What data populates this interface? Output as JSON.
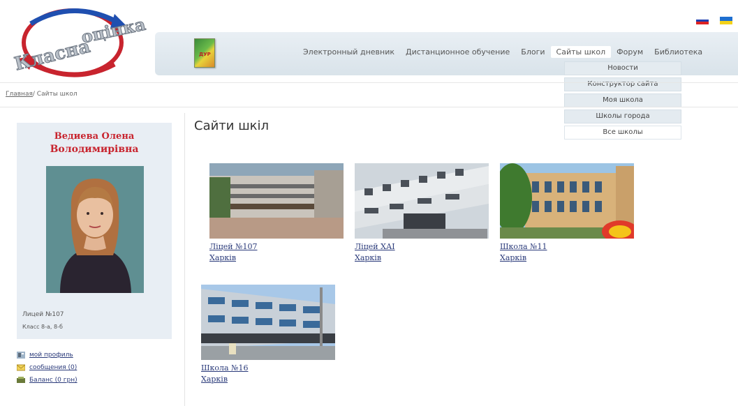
{
  "logo": {
    "text": "Класна оцінка"
  },
  "flags": [
    {
      "name": "russian-flag",
      "colors": [
        "#ffffff",
        "#1f3fb0",
        "#d22"
      ]
    },
    {
      "name": "ukrainian-flag",
      "colors": [
        "#1e6fd0",
        "#f4d21a"
      ]
    }
  ],
  "nav": {
    "items": [
      {
        "label": "Электронный дневник",
        "active": false
      },
      {
        "label": "Дистанционное обучение",
        "active": false
      },
      {
        "label": "Блоги",
        "active": false
      },
      {
        "label": "Сайты школ",
        "active": true
      },
      {
        "label": "Форум",
        "active": false
      },
      {
        "label": "Библиотека",
        "active": false
      }
    ],
    "dropdown": [
      "Новости",
      "Конструктор сайта",
      "Моя школа",
      "Школы города",
      "Все школы"
    ]
  },
  "breadcrumb": {
    "home": "Главная",
    "separator": "/",
    "current": "Сайты школ"
  },
  "profile": {
    "name_line1": "Ведиева Олена",
    "name_line2": "Володимирівна",
    "school": "Лицей №107",
    "class": "Класс 8-а, 8-б"
  },
  "sidebar_links": [
    {
      "label": "мой профиль",
      "icon": "profile-icon"
    },
    {
      "label": "сообщения (0)",
      "icon": "envelope-icon"
    },
    {
      "label": "Баланс (0 грн)",
      "icon": "wallet-icon"
    }
  ],
  "page_title": "Сайти шкіл",
  "schools": [
    {
      "name": "Ліцей №107",
      "city": "Харків"
    },
    {
      "name": "Ліцей ХАІ",
      "city": "Харків"
    },
    {
      "name": "Школа №11",
      "city": "Харків"
    },
    {
      "name": "Школа №16",
      "city": "Харків"
    }
  ],
  "colors": {
    "accent_red": "#c8242e",
    "link": "#2a3a7a",
    "nav_bg": "#e0e8ee"
  }
}
